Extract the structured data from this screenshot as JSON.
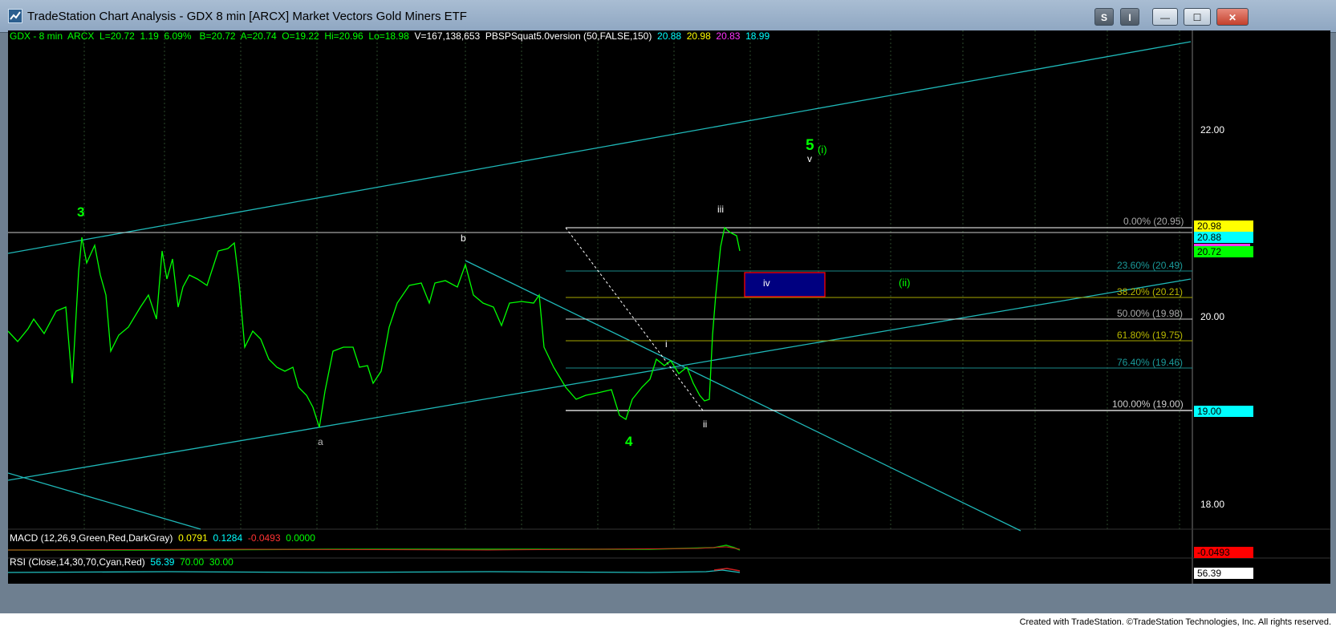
{
  "window": {
    "title": "TradeStation Chart Analysis - GDX 8 min [ARCX] Market Vectors Gold Miners ETF",
    "btn_s": "S",
    "btn_i": "I",
    "btn_min": "—",
    "btn_max": "☐",
    "btn_close": "✕"
  },
  "info_bar": {
    "symbol": "GDX - 8 min",
    "exchange": "ARCX",
    "last": "L=20.72",
    "change": "1.19",
    "pct": "6.09%",
    "bid": "B=20.72",
    "ask": "A=20.74",
    "open": "O=19.22",
    "high": "Hi=20.96",
    "low": "Lo=18.98",
    "volume": "V=167,138,653",
    "indicator": "PBSPSquat5.0version (50,FALSE,150)",
    "ind_values": [
      "20.88",
      "20.98",
      "20.83",
      "18.99"
    ]
  },
  "price_axis": {
    "ticks": [
      "22.00",
      "20.00",
      "18.00"
    ],
    "badges": [
      {
        "text": "20.98",
        "color": "#ffff00",
        "fg": "#000"
      },
      {
        "text": "20.88",
        "color": "#00ffff",
        "fg": "#000"
      },
      {
        "text": "20.72",
        "color": "#00ff00",
        "fg": "#000"
      },
      {
        "text": "19.00",
        "color": "#00ffff",
        "fg": "#000"
      }
    ]
  },
  "fibs": [
    {
      "label": "0.00% (20.95)"
    },
    {
      "label": "23.60% (20.49)"
    },
    {
      "label": "38.20% (20.21)"
    },
    {
      "label": "50.00% (19.98)"
    },
    {
      "label": "61.80% (19.75)"
    },
    {
      "label": "76.40% (19.46)"
    },
    {
      "label": "100.00% (19.00)"
    }
  ],
  "wave_labels": {
    "w3": "3",
    "w4": "4",
    "w5": "5",
    "wi_paren": "(i)",
    "wii_paren": "(ii)",
    "a": "a",
    "b": "b",
    "i": "i",
    "ii": "ii",
    "iii": "iii",
    "iv": "iv",
    "v": "v"
  },
  "macd": {
    "title": "MACD (12,26,9,Green,Red,DarkGray)",
    "values": [
      "0.0791",
      "0.1284",
      "-0.0493",
      "0.0000"
    ],
    "badge": "-0.0493"
  },
  "rsi": {
    "title": "RSI (Close,14,30,70,Cyan,Red)",
    "values": [
      "56.39",
      "70.00",
      "30.00"
    ],
    "badge": "56.39"
  },
  "footer": "Created with TradeStation. ©TradeStation Technologies, Inc. All rights reserved.",
  "colors": {
    "price": "#00ff00",
    "channel": "#20c0c0",
    "waves": "#00ff00",
    "box": "#000080"
  }
}
